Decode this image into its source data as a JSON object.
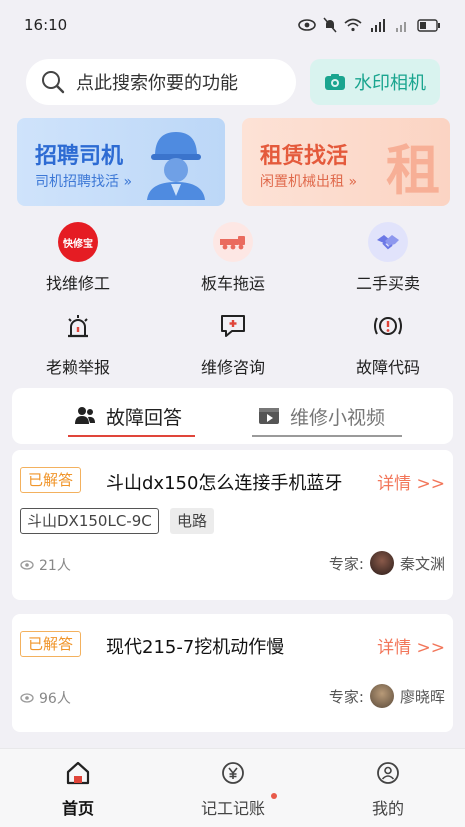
{
  "status_bar": {
    "time": "16:10"
  },
  "search": {
    "placeholder": "点此搜索你要的功能"
  },
  "camera_button": {
    "label": "水印相机"
  },
  "banners": {
    "driver": {
      "title": "招聘司机",
      "subtitle": "司机招聘找活 »"
    },
    "rent": {
      "title": "租赁找活",
      "subtitle": "闲置机械出租 »",
      "big_char": "租"
    }
  },
  "quick_actions": [
    {
      "label": "找维修工",
      "icon_text": "快修宝",
      "icon": "kuaixiubao-logo"
    },
    {
      "label": "板车拖运",
      "icon": "truck-icon"
    },
    {
      "label": "二手买卖",
      "icon": "handshake-icon"
    },
    {
      "label": "老赖举报",
      "icon": "alarm-icon"
    },
    {
      "label": "维修咨询",
      "icon": "chat-plus-icon"
    },
    {
      "label": "故障代码",
      "icon": "fault-code-icon"
    }
  ],
  "tabs": [
    {
      "label": "故障回答",
      "active": true
    },
    {
      "label": "维修小视频",
      "active": false
    }
  ],
  "questions": [
    {
      "status": "已解答",
      "title": "斗山dx150怎么连接手机蓝牙",
      "detail": "详情 >>",
      "model_tag": "斗山DX150LC-9C",
      "category_tag": "电路",
      "views": "21人",
      "expert_label": "专家:",
      "expert_name": "秦文渊"
    },
    {
      "status": "已解答",
      "title": "现代215-7挖机动作慢",
      "detail": "详情 >>",
      "views": "96人",
      "expert_label": "专家:",
      "expert_name": "廖晓晖"
    }
  ],
  "bottom_nav": [
    {
      "label": "首页",
      "active": true
    },
    {
      "label": "记工记账",
      "active": false,
      "dot": true
    },
    {
      "label": "我的",
      "active": false
    }
  ],
  "colors": {
    "accent_red": "#e0453a",
    "badge_orange": "#f0952a",
    "camera_teal": "#1aa58f",
    "driver_blue": "#2d6bd3",
    "rent_orange": "#e45a3c"
  }
}
